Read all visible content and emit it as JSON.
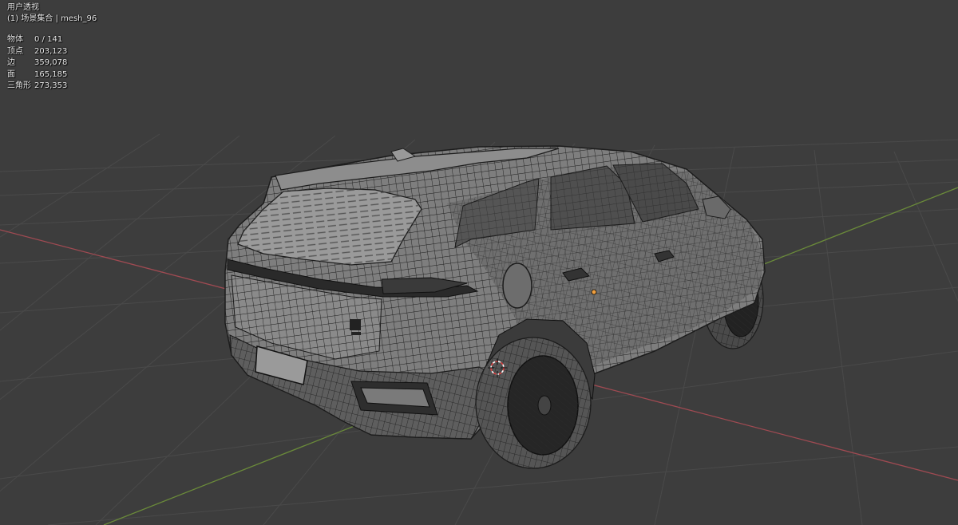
{
  "viewport": {
    "view_name": "用户透视",
    "collection_label": "(1) 场景集合 | mesh_96"
  },
  "stats": [
    {
      "label": "物体",
      "value": "0 / 141"
    },
    {
      "label": "顶点",
      "value": "203,123"
    },
    {
      "label": "边",
      "value": "359,078"
    },
    {
      "label": "面",
      "value": "165,185"
    },
    {
      "label": "三角形",
      "value": "273,353"
    }
  ],
  "colors": {
    "background": "#3d3d3d",
    "grid": "#4a4a4a",
    "x_axis": "#a04a52",
    "y_axis": "#6a8a3a",
    "mesh_fill": "#7e7e7e",
    "mesh_dark": "#474747",
    "wire": "#1c1c1c",
    "origin": "#f0a040",
    "cursor": "#e04040"
  },
  "icons": {
    "origin": "object-origin-dot",
    "cursor": "3d-cursor-icon"
  }
}
